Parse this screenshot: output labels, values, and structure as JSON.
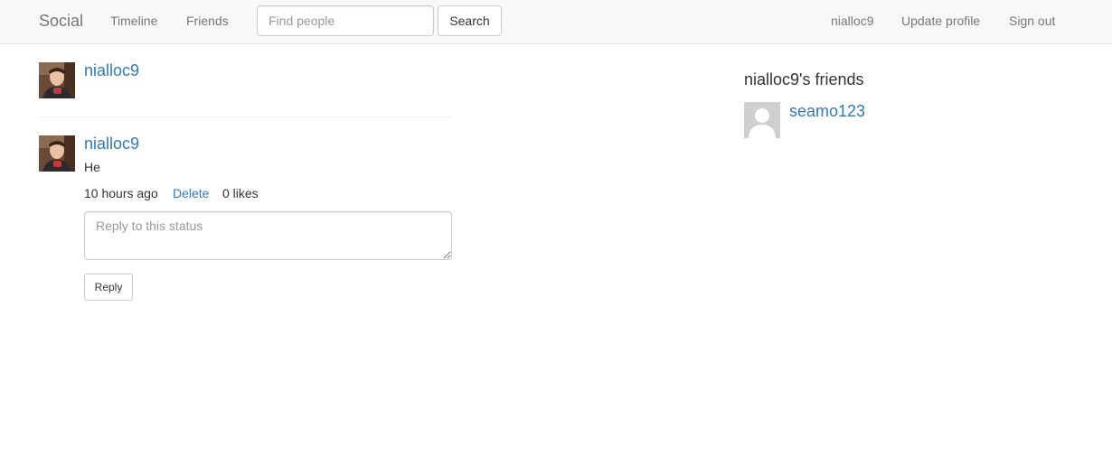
{
  "navbar": {
    "brand": "Social",
    "links": [
      "Timeline",
      "Friends"
    ],
    "search": {
      "placeholder": "Find people",
      "value": "",
      "button_label": "Search"
    },
    "right_links": [
      "nialloc9",
      "Update profile",
      "Sign out"
    ]
  },
  "profile": {
    "username": "nialloc9"
  },
  "status": {
    "username": "nialloc9",
    "text": "He",
    "time": "10 hours ago",
    "delete_label": "Delete",
    "likes": "0 likes",
    "reply_placeholder": "Reply to this status",
    "reply_button": "Reply"
  },
  "friends": {
    "heading": "nialloc9's friends",
    "items": [
      {
        "username": "seamo123"
      }
    ]
  },
  "colors": {
    "link": "#337ab7",
    "navbar_bg": "#f8f8f8",
    "nav_text": "#777777"
  }
}
